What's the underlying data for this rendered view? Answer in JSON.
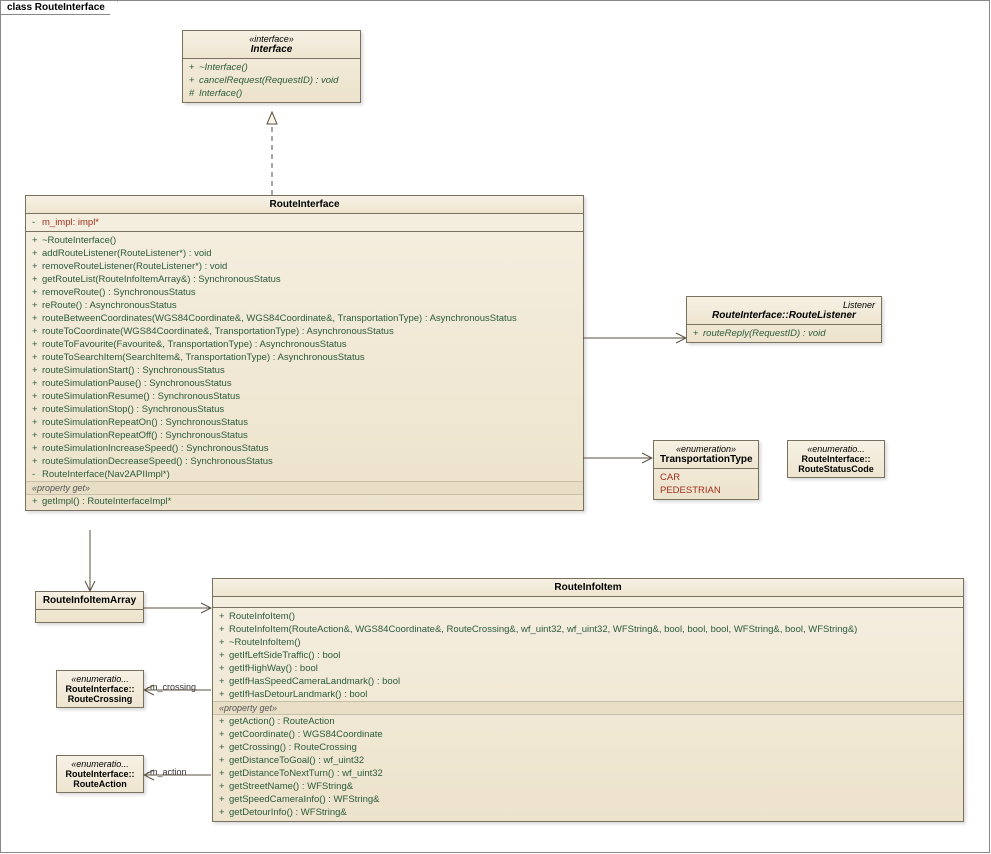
{
  "frame": {
    "title": "class RouteInterface"
  },
  "interface": {
    "stereotype": "«interface»",
    "name": "Interface",
    "ops": [
      {
        "vis": "+",
        "sig": "~Interface()"
      },
      {
        "vis": "+",
        "sig": "cancelRequest(RequestID) : void"
      },
      {
        "vis": "#",
        "sig": "Interface()"
      }
    ]
  },
  "routeInterface": {
    "name": "RouteInterface",
    "attrs": [
      {
        "vis": "-",
        "sig": "m_impl:  impl*"
      }
    ],
    "ops": [
      {
        "vis": "+",
        "sig": "~RouteInterface()"
      },
      {
        "vis": "+",
        "sig": "addRouteListener(RouteListener*) : void"
      },
      {
        "vis": "+",
        "sig": "removeRouteListener(RouteListener*) : void"
      },
      {
        "vis": "+",
        "sig": "getRouteList(RouteInfoItemArray&) : SynchronousStatus"
      },
      {
        "vis": "+",
        "sig": "removeRoute() : SynchronousStatus"
      },
      {
        "vis": "+",
        "sig": "reRoute() : AsynchronousStatus"
      },
      {
        "vis": "+",
        "sig": "routeBetweenCoordinates(WGS84Coordinate&, WGS84Coordinate&, TransportationType) : AsynchronousStatus"
      },
      {
        "vis": "+",
        "sig": "routeToCoordinate(WGS84Coordinate&, TransportationType) : AsynchronousStatus"
      },
      {
        "vis": "+",
        "sig": "routeToFavourite(Favourite&, TransportationType) : AsynchronousStatus"
      },
      {
        "vis": "+",
        "sig": "routeToSearchItem(SearchItem&, TransportationType) : AsynchronousStatus"
      },
      {
        "vis": "+",
        "sig": "routeSimulationStart() : SynchronousStatus"
      },
      {
        "vis": "+",
        "sig": "routeSimulationPause() : SynchronousStatus"
      },
      {
        "vis": "+",
        "sig": "routeSimulationResume() : SynchronousStatus"
      },
      {
        "vis": "+",
        "sig": "routeSimulationStop() : SynchronousStatus"
      },
      {
        "vis": "+",
        "sig": "routeSimulationRepeatOn() : SynchronousStatus"
      },
      {
        "vis": "+",
        "sig": "routeSimulationRepeatOff() : SynchronousStatus"
      },
      {
        "vis": "+",
        "sig": "routeSimulationIncreaseSpeed() : SynchronousStatus"
      },
      {
        "vis": "+",
        "sig": "routeSimulationDecreaseSpeed() : SynchronousStatus"
      },
      {
        "vis": "-",
        "sig": "RouteInterface(Nav2APIImpl*)"
      }
    ],
    "propGetLabel": "«property get»",
    "propGet": [
      {
        "vis": "+",
        "sig": "getImpl() : RouteInterfaceImpl*"
      }
    ]
  },
  "routeListener": {
    "stereoRight": "Listener",
    "name": "RouteInterface::RouteListener",
    "ops": [
      {
        "vis": "+",
        "sig": "routeReply(RequestID) : void"
      }
    ]
  },
  "transportationType": {
    "stereotype": "«enumeration»",
    "name": "TransportationType",
    "literals": [
      "CAR",
      "PEDESTRIAN"
    ]
  },
  "routeStatusCode": {
    "stereotype": "«enumeratio...",
    "name": "RouteInterface::\nRouteStatusCode"
  },
  "routeInfoItemArray": {
    "name": "RouteInfoItemArray"
  },
  "routeCrossing": {
    "stereotype": "«enumeratio...",
    "name": "RouteInterface::\nRouteCrossing"
  },
  "routeAction": {
    "stereotype": "«enumeratio...",
    "name": "RouteInterface::\nRouteAction"
  },
  "routeInfoItem": {
    "name": "RouteInfoItem",
    "ops": [
      {
        "vis": "+",
        "sig": "RouteInfoItem()"
      },
      {
        "vis": "+",
        "sig": "RouteInfoItem(RouteAction&, WGS84Coordinate&, RouteCrossing&, wf_uint32, wf_uint32, WFString&, bool, bool, bool, WFString&, bool, WFString&)"
      },
      {
        "vis": "+",
        "sig": "~RouteInfoItem()"
      },
      {
        "vis": "+",
        "sig": "getIfLeftSideTraffic() : bool"
      },
      {
        "vis": "+",
        "sig": "getIfHighWay() : bool"
      },
      {
        "vis": "+",
        "sig": "getIfHasSpeedCameraLandmark() : bool"
      },
      {
        "vis": "+",
        "sig": "getIfHasDetourLandmark() : bool"
      }
    ],
    "propGetLabel": "«property get»",
    "propGet": [
      {
        "vis": "+",
        "sig": "getAction() : RouteAction"
      },
      {
        "vis": "+",
        "sig": "getCoordinate() : WGS84Coordinate"
      },
      {
        "vis": "+",
        "sig": "getCrossing() : RouteCrossing"
      },
      {
        "vis": "+",
        "sig": "getDistanceToGoal() : wf_uint32"
      },
      {
        "vis": "+",
        "sig": "getDistanceToNextTurn() : wf_uint32"
      },
      {
        "vis": "+",
        "sig": "getStreetName() : WFString&"
      },
      {
        "vis": "+",
        "sig": "getSpeedCameraInfo() : WFString&"
      },
      {
        "vis": "+",
        "sig": "getDetourInfo() : WFString&"
      }
    ]
  },
  "assocLabels": {
    "m_crossing": "-m_crossing",
    "m_action": "-m_action"
  }
}
